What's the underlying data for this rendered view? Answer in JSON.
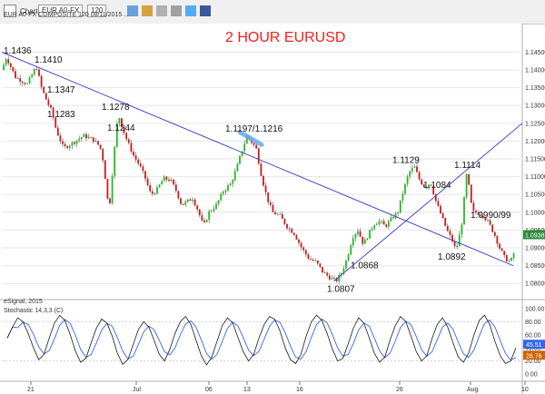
{
  "toolbar": {
    "chart_tab": "Chart",
    "symbol": "EUR A0-FX",
    "interval": "120",
    "header_info": "EUR A0-FX COMPOSITE 120 08/11/2015 ...",
    "vendor": "eSignal, 2015"
  },
  "chart_data": {
    "type": "candlestick",
    "title": "2 HOUR EURUSD",
    "ylim": [
      1.0775,
      1.152
    ],
    "y_ticks": [
      1.145,
      1.14,
      1.135,
      1.13,
      1.125,
      1.12,
      1.115,
      1.11,
      1.105,
      1.1,
      1.095,
      1.09,
      1.085,
      1.08
    ],
    "y_tick_labels": [
      "1.14500",
      "1.14000",
      "1.13500",
      "1.13000",
      "1.12500",
      "1.12000",
      "1.11500",
      "1.11000",
      "1.10500",
      "1.10000",
      "1.09500",
      "1.09000",
      "1.08500",
      "1.08000"
    ],
    "current_price": 1.0937,
    "current_price_label": "1.09387",
    "x_tick_labels": [
      "21",
      "Jul",
      "06",
      "13",
      "16",
      "26",
      "Aug",
      "10"
    ],
    "annotations": [
      {
        "text": "1.1436",
        "value": 1.1436
      },
      {
        "text": "1.1410",
        "value": 1.141
      },
      {
        "text": "1.1347",
        "value": 1.1347
      },
      {
        "text": "1.1283",
        "value": 1.1283
      },
      {
        "text": "1.1278",
        "value": 1.1278
      },
      {
        "text": "1.1244",
        "value": 1.1244
      },
      {
        "text": "1.1197/1.1216",
        "value": 1.1216
      },
      {
        "text": "1.1129",
        "value": 1.1129
      },
      {
        "text": "1.1084",
        "value": 1.1084
      },
      {
        "text": "1.1114",
        "value": 1.1114
      },
      {
        "text": "1.0990/99",
        "value": 1.0999
      },
      {
        "text": "1.0892",
        "value": 1.0892
      },
      {
        "text": "1.0868",
        "value": 1.0868
      },
      {
        "text": "1.0807",
        "value": 1.0807
      }
    ],
    "trendlines": [
      {
        "name": "downtrend",
        "from": 1.145,
        "to": 1.085
      },
      {
        "name": "uptrend",
        "from": 1.0807,
        "to": 1.125
      }
    ],
    "path": [
      [
        0,
        1.14
      ],
      [
        5,
        1.1436
      ],
      [
        15,
        1.138
      ],
      [
        28,
        1.136
      ],
      [
        38,
        1.141
      ],
      [
        44,
        1.1347
      ],
      [
        50,
        1.131
      ],
      [
        55,
        1.1283
      ],
      [
        60,
        1.123
      ],
      [
        68,
        1.118
      ],
      [
        78,
        1.1195
      ],
      [
        90,
        1.1215
      ],
      [
        100,
        1.1205
      ],
      [
        108,
        1.1185
      ],
      [
        112,
        1.114
      ],
      [
        118,
        1.1
      ],
      [
        123,
        1.115
      ],
      [
        128,
        1.1278
      ],
      [
        132,
        1.1244
      ],
      [
        138,
        1.12
      ],
      [
        145,
        1.116
      ],
      [
        152,
        1.113
      ],
      [
        158,
        1.1095
      ],
      [
        164,
        1.105
      ],
      [
        170,
        1.106
      ],
      [
        178,
        1.1095
      ],
      [
        186,
        1.109
      ],
      [
        192,
        1.106
      ],
      [
        198,
        1.102
      ],
      [
        204,
        1.103
      ],
      [
        210,
        1.104
      ],
      [
        216,
        1.1005
      ],
      [
        222,
        1.096
      ],
      [
        228,
        1.1
      ],
      [
        236,
        1.102
      ],
      [
        244,
        1.106
      ],
      [
        252,
        1.108
      ],
      [
        258,
        1.112
      ],
      [
        264,
        1.117
      ],
      [
        270,
        1.1216
      ],
      [
        275,
        1.1197
      ],
      [
        280,
        1.118
      ],
      [
        286,
        1.11
      ],
      [
        292,
        1.104
      ],
      [
        298,
        1.1
      ],
      [
        306,
        1.099
      ],
      [
        314,
        1.096
      ],
      [
        322,
        1.094
      ],
      [
        330,
        1.09
      ],
      [
        338,
        1.087
      ],
      [
        346,
        1.086
      ],
      [
        354,
        1.083
      ],
      [
        362,
        1.0815
      ],
      [
        368,
        1.0807
      ],
      [
        374,
        1.083
      ],
      [
        380,
        1.087
      ],
      [
        386,
        1.093
      ],
      [
        392,
        1.095
      ],
      [
        398,
        1.091
      ],
      [
        404,
        1.094
      ],
      [
        410,
        1.0968
      ],
      [
        416,
        1.0975
      ],
      [
        422,
        1.096
      ],
      [
        430,
        1.0985
      ],
      [
        436,
        1.1
      ],
      [
        442,
        1.106
      ],
      [
        448,
        1.111
      ],
      [
        454,
        1.1129
      ],
      [
        460,
        1.109
      ],
      [
        466,
        1.107
      ],
      [
        472,
        1.1084
      ],
      [
        478,
        1.103
      ],
      [
        484,
        1.099
      ],
      [
        490,
        1.095
      ],
      [
        496,
        1.092
      ],
      [
        500,
        1.0892
      ],
      [
        506,
        1.096
      ],
      [
        512,
        1.1114
      ],
      [
        518,
        1.1
      ],
      [
        524,
        1.0999
      ],
      [
        530,
        1.099
      ],
      [
        536,
        1.097
      ],
      [
        542,
        1.094
      ],
      [
        548,
        1.09
      ],
      [
        554,
        1.087
      ],
      [
        560,
        1.086
      ],
      [
        566,
        1.09
      ]
    ],
    "oscillator": {
      "name": "Stochastic",
      "header": "Stochastic 14,3,3 (C)",
      "ylim": [
        0,
        100
      ],
      "ticks": [
        100,
        80,
        60,
        40,
        20,
        0
      ],
      "tick_labels": [
        "100.00",
        "80.00",
        "60.00",
        "40.00",
        "20.00",
        "0.00"
      ],
      "k_last_label": "45.51",
      "d_last_label": "28.76",
      "values": [
        55,
        72,
        86,
        80,
        62,
        40,
        22,
        30,
        55,
        78,
        90,
        82,
        60,
        35,
        18,
        24,
        48,
        70,
        84,
        78,
        58,
        32,
        15,
        22,
        45,
        68,
        80,
        72,
        52,
        30,
        20,
        38,
        62,
        80,
        88,
        76,
        52,
        28,
        14,
        26,
        50,
        74,
        86,
        78,
        56,
        34,
        20,
        30,
        55,
        76,
        88,
        84,
        66,
        40,
        22,
        16,
        30,
        58,
        80,
        90,
        82,
        62,
        38,
        20,
        24,
        46,
        70,
        86,
        78,
        56,
        32,
        18,
        26,
        52,
        74,
        88,
        80,
        58,
        34,
        20,
        28,
        54,
        76,
        86,
        72,
        48,
        26,
        18,
        32,
        60,
        82,
        90,
        76,
        50,
        28,
        16,
        20,
        40
      ]
    },
    "colors": {
      "up": "#22bb22",
      "down": "#cc1a1a",
      "trendline": "#3333cc",
      "highlight": "#66aaee",
      "osc_k": "#1a1a1a",
      "osc_d": "#3366ee"
    }
  }
}
